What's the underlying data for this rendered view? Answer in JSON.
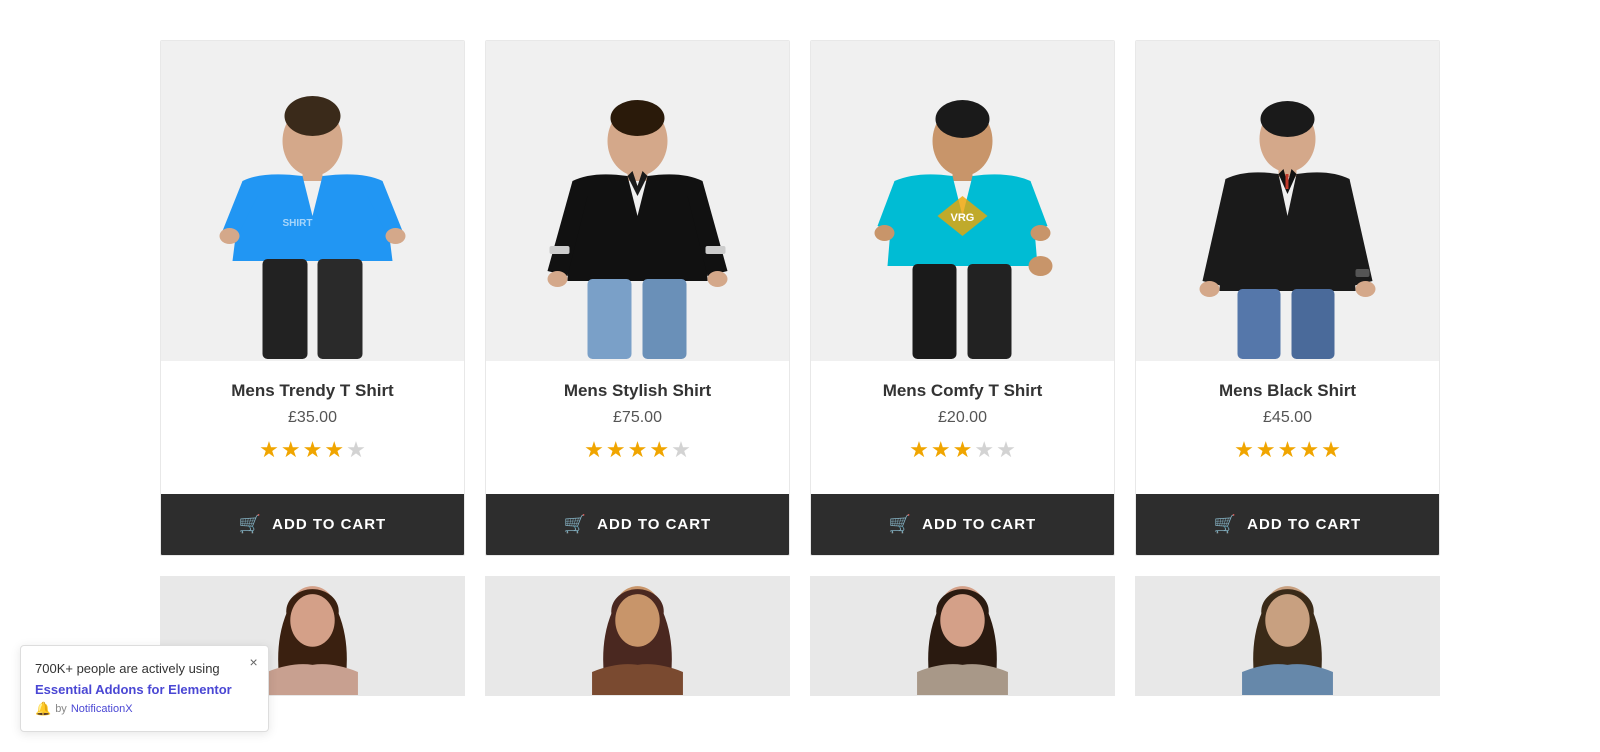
{
  "products_row1": [
    {
      "id": "product-1",
      "name": "Mens Trendy T Shirt",
      "price": "£35.00",
      "stars": 4,
      "max_stars": 5,
      "btn_label": "ADD TO CART",
      "shirt_color": "#2196F3",
      "shirt_type": "tshirt"
    },
    {
      "id": "product-2",
      "name": "Mens Stylish Shirt",
      "price": "£75.00",
      "stars": 4,
      "max_stars": 5,
      "btn_label": "ADD TO CART",
      "shirt_color": "#1a1a1a",
      "shirt_type": "shirt"
    },
    {
      "id": "product-3",
      "name": "Mens Comfy T Shirt",
      "price": "£20.00",
      "stars": 3,
      "max_stars": 5,
      "btn_label": "ADD TO CART",
      "shirt_color": "#00bcd4",
      "shirt_type": "tshirt"
    },
    {
      "id": "product-4",
      "name": "Mens Black Shirt",
      "price": "£45.00",
      "stars": 5,
      "max_stars": 5,
      "btn_label": "ADD TO CART",
      "shirt_color": "#1a1a1a",
      "shirt_type": "shirt"
    }
  ],
  "notification": {
    "main_text": "700K+ people are actively using",
    "link_text": "Essential Addons for Elementor",
    "by_text": "by",
    "brand_text": "NotificationX",
    "close_label": "×"
  }
}
